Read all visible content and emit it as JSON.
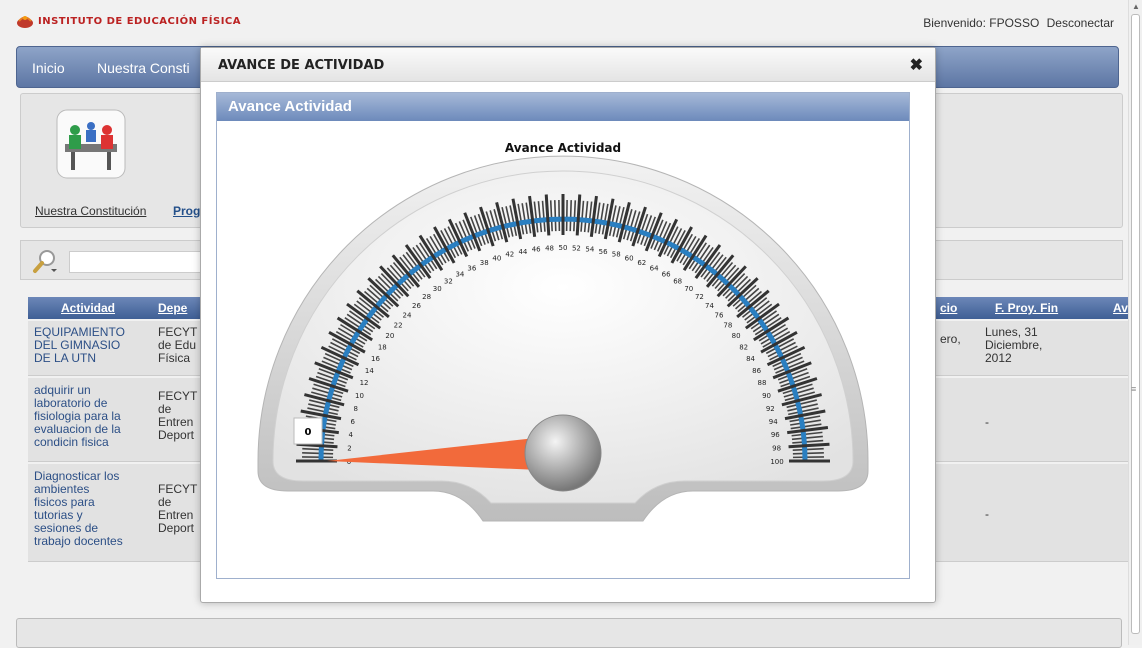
{
  "header": {
    "institute": "INSTITUTO DE EDUCACIÓN FÍSICA",
    "welcome": "Bienvenido: FPOSSO",
    "logout": "Desconectar"
  },
  "nav": {
    "items": [
      "Inicio",
      "Nuestra Consti"
    ]
  },
  "panel": {
    "links": [
      "Nuestra Constitución",
      "Prog"
    ]
  },
  "table": {
    "headers": [
      "Actividad",
      "Depe",
      "cio",
      "F. Proy. Fin",
      "Av"
    ],
    "rows": [
      {
        "actividad": "EQUIPAMIENTO\nDEL GIMNASIO\nDE LA UTN",
        "dep": "FECYT\nde Edu\nFísica",
        "inicio": "ero,",
        "fin": "Lunes, 31\nDiciembre,\n2012"
      },
      {
        "actividad": "adquirir un\nlaboratorio de\nfisiologia para la\nevaluacion de la\ncondicin fisica",
        "dep": "FECYT\nde\nEntren\nDeport",
        "inicio": "",
        "fin": "-"
      },
      {
        "actividad": "Diagnosticar los\nambientes\nfisicos para\ntutorias y\nsesiones de\ntrabajo docentes",
        "dep": "FECYT\nde\nEntren\nDeport",
        "inicio": "",
        "fin": "-"
      }
    ]
  },
  "modal": {
    "title": "AVANCE DE ACTIVIDAD",
    "close": "✖",
    "panel_title": "Avance Actividad"
  },
  "chart_data": {
    "type": "gauge",
    "title": "Avance Actividad",
    "min": 0,
    "max": 100,
    "major_tick_step": 2,
    "value": 0,
    "value_label": "0",
    "needle_color": "#f26a3b",
    "tick_color": "#2a7fc1"
  }
}
